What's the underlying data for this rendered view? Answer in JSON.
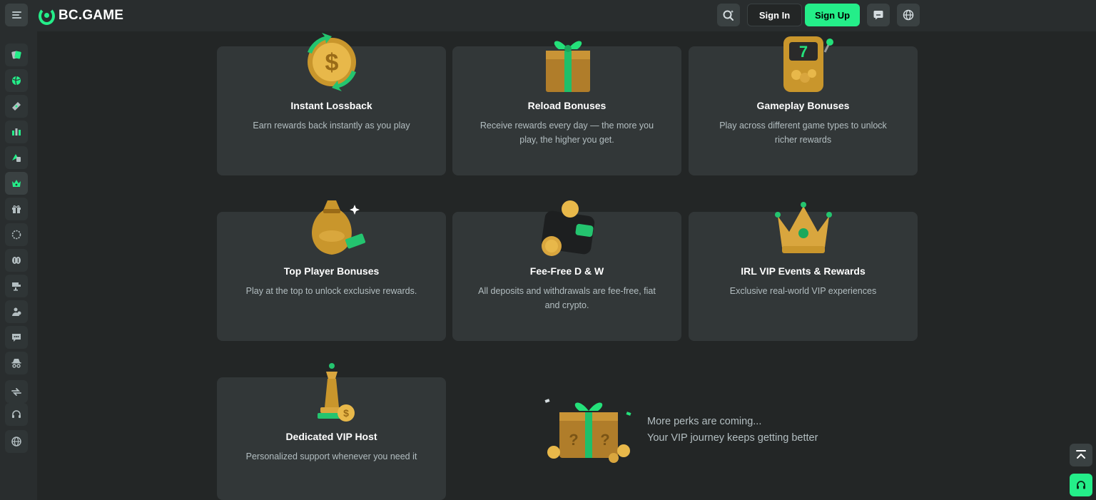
{
  "header": {
    "logo_text": "BC.GAME",
    "signin_label": "Sign In",
    "signup_label": "Sign Up"
  },
  "colors": {
    "accent": "#24ee89",
    "card_bg": "#323738",
    "page_bg": "#232626",
    "header_bg": "#292d2e",
    "muted_text": "#b3bec1"
  },
  "sidebar": {
    "items": [
      {
        "icon": "cards-icon"
      },
      {
        "icon": "sports-ball-icon"
      },
      {
        "icon": "ticket-icon"
      },
      {
        "icon": "trading-chart-icon"
      },
      {
        "icon": "lottery-icon"
      },
      {
        "icon": "vip-crown-icon",
        "active": true
      },
      {
        "icon": "gift-icon"
      },
      {
        "icon": "spin-wheel-icon"
      },
      {
        "icon": "chips-icon"
      },
      {
        "icon": "leaderboard-icon"
      },
      {
        "icon": "affiliate-icon"
      },
      {
        "icon": "chat-icon"
      },
      {
        "icon": "spy-icon"
      },
      {
        "icon": "exchange-icon"
      },
      {
        "icon": "support-headset-icon"
      },
      {
        "icon": "globe-icon"
      }
    ]
  },
  "cards": [
    {
      "title": "Instant Lossback",
      "desc": "Earn rewards back instantly as you play",
      "art": "gold-coin-refresh-icon"
    },
    {
      "title": "Reload Bonuses",
      "desc": "Receive rewards every day — the more you play, the higher you get.",
      "art": "gift-box-icon"
    },
    {
      "title": "Gameplay Bonuses",
      "desc": "Play across different game types to unlock richer rewards",
      "art": "slot-machine-icon"
    },
    {
      "title": "Top Player Bonuses",
      "desc": "Play at the top to unlock exclusive rewards.",
      "art": "money-bag-icon"
    },
    {
      "title": "Fee-Free D & W",
      "desc": "All deposits and withdrawals are fee-free, fiat and crypto.",
      "art": "wallet-coins-icon"
    },
    {
      "title": "IRL VIP Events & Rewards",
      "desc": "Exclusive real-world VIP experiences",
      "art": "crown-icon"
    },
    {
      "title": "Dedicated VIP Host",
      "desc": "Personalized support whenever you need it",
      "art": "chess-king-icon"
    }
  ],
  "perks": {
    "line1": "More perks are coming...",
    "line2": "Your VIP journey keeps getting better",
    "art": "mystery-box-icon"
  }
}
